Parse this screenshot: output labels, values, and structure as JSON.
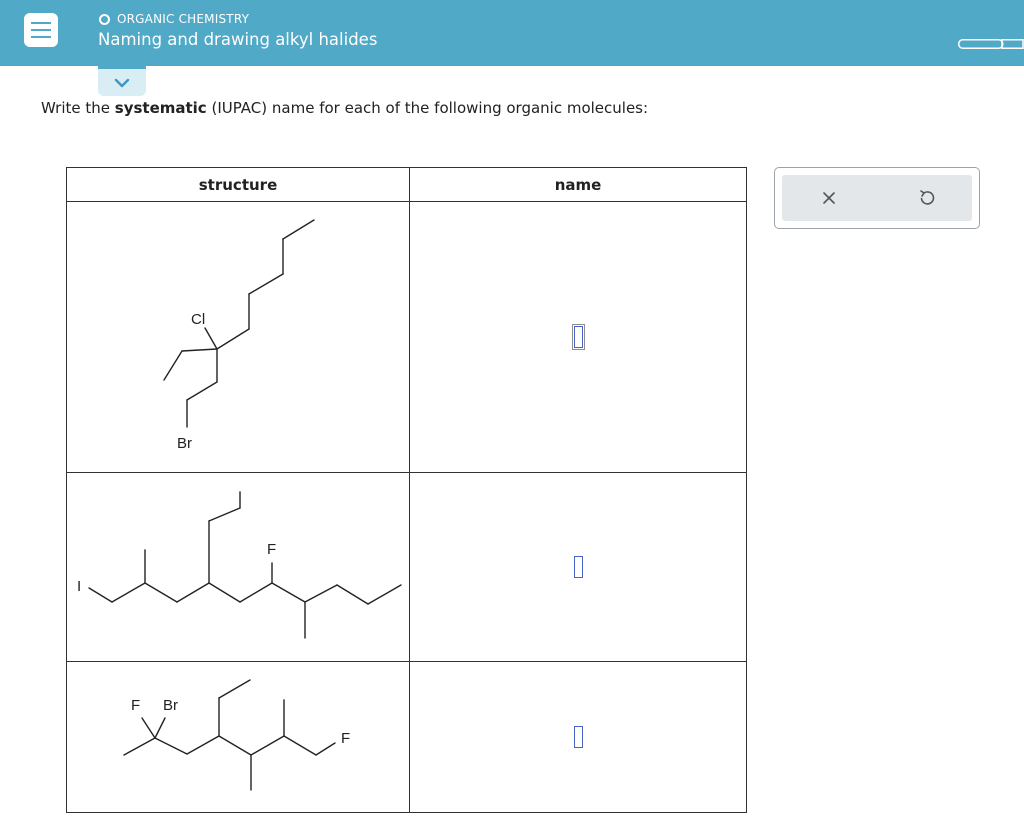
{
  "header": {
    "topic": "ORGANIC CHEMISTRY",
    "title": "Naming and drawing alkyl halides",
    "menu_icon": "hamburger-menu-icon",
    "expand_icon": "chevron-down-icon",
    "progress_icon": "progress-bar-icon"
  },
  "instructions": {
    "prefix": "Write the ",
    "emphasis": "systematic",
    "suffix": " (IUPAC) name for each of the following organic molecules:"
  },
  "table": {
    "headers": {
      "structure": "structure",
      "name": "name"
    },
    "rows": [
      {
        "atom_labels": [
          "Cl",
          "Br"
        ],
        "name_value": ""
      },
      {
        "atom_labels": [
          "I",
          "F"
        ],
        "name_value": ""
      },
      {
        "atom_labels": [
          "F",
          "Br",
          "F"
        ],
        "name_value": ""
      }
    ]
  },
  "tools": {
    "clear_icon": "x-icon",
    "undo_icon": "undo-icon"
  },
  "colors": {
    "header_bg": "#4fa9c7",
    "answer_box": "#4a63c9",
    "tools_bg": "#e4e7ea"
  }
}
